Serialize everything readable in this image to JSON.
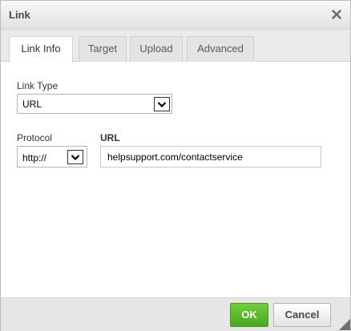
{
  "dialog": {
    "title": "Link",
    "close_icon": "close-icon"
  },
  "tabs": [
    {
      "label": "Link Info",
      "active": true
    },
    {
      "label": "Target",
      "active": false
    },
    {
      "label": "Upload",
      "active": false
    },
    {
      "label": "Advanced",
      "active": false
    }
  ],
  "link_type": {
    "label": "Link Type",
    "selected": "URL"
  },
  "protocol": {
    "label": "Protocol",
    "selected": "http://"
  },
  "url": {
    "label": "URL",
    "value": "helpsupport.com/contactservice"
  },
  "buttons": {
    "ok": "OK",
    "cancel": "Cancel"
  },
  "colors": {
    "ok_green": "#5cbd2d",
    "title_text": "#474747"
  }
}
